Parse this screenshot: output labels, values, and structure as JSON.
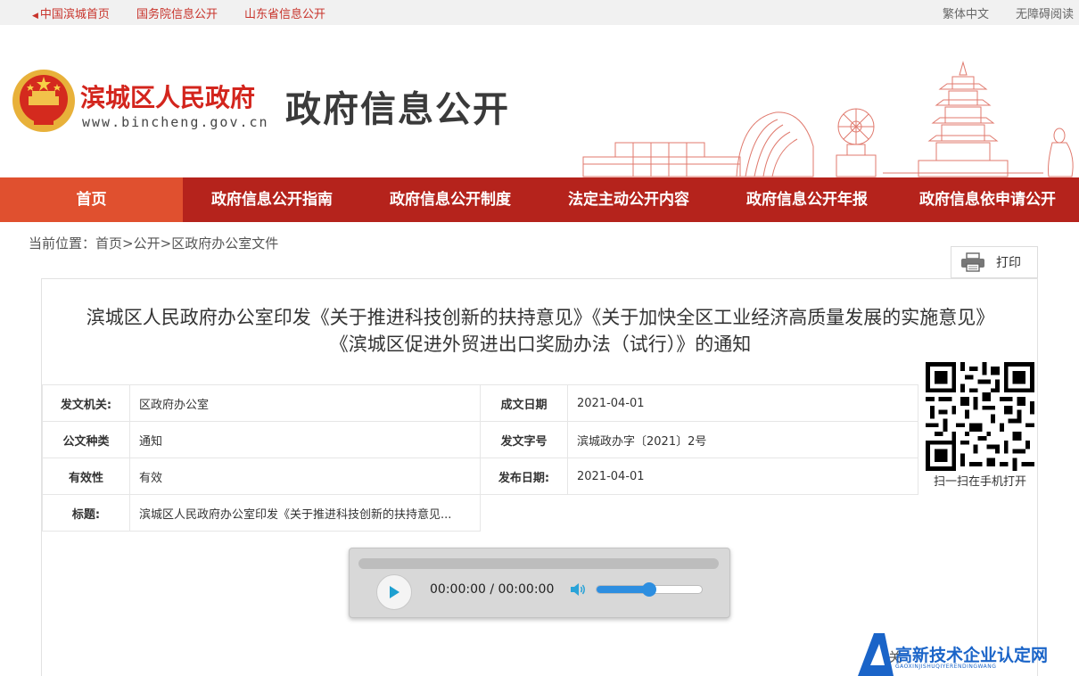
{
  "topbar": {
    "left_links": [
      "中国滨城首页",
      "国务院信息公开",
      "山东省信息公开"
    ],
    "right_links": [
      "繁体中文",
      "无障碍阅读"
    ]
  },
  "header": {
    "site_name": "滨城区人民政府",
    "site_url": "www.bincheng.gov.cn",
    "portal_title": "政府信息公开"
  },
  "nav": {
    "items": [
      "首页",
      "政府信息公开指南",
      "政府信息公开制度",
      "法定主动公开内容",
      "政府信息公开年报",
      "政府信息依申请公开"
    ]
  },
  "breadcrumb": {
    "prefix": "当前位置：",
    "items": [
      "首页",
      "公开",
      "区政府办公室文件"
    ],
    "separator": ">"
  },
  "print": {
    "label": "打印"
  },
  "document": {
    "title_line1": "滨城区人民政府办公室印发《关于推进科技创新的扶持意见》《关于加快全区工业经济高质量发展的实施意见》",
    "title_line2": "《滨城区促进外贸进出口奖励办法（试行）》的通知",
    "meta": {
      "issuer_label": "发文机关:",
      "issuer": "区政府办公室",
      "written_date_label": "成文日期",
      "written_date": "2021-04-01",
      "type_label": "公文种类",
      "type": "通知",
      "doc_number_label": "发文字号",
      "doc_number": "滨城政办字〔2021〕2号",
      "validity_label": "有效性",
      "validity": "有效",
      "publish_date_label": "发布日期:",
      "publish_date": "2021-04-01",
      "subject_label": "标题:",
      "subject": "滨城区人民政府办公室印发《关于推进科技创新的扶持意见..."
    },
    "qr_caption": "扫一扫在手机打开"
  },
  "audio": {
    "time": "00:00:00 / 00:00:00",
    "volume": 0.5
  },
  "watermark": {
    "text": "高新技术企业认定网",
    "sub": "GAOXINJISHUQIYERENDINGWANG"
  },
  "colors": {
    "nav_bg": "#b5231c",
    "nav_active": "#e0502f",
    "brand_red": "#d3251d",
    "accent_blue": "#2d8ee0"
  }
}
